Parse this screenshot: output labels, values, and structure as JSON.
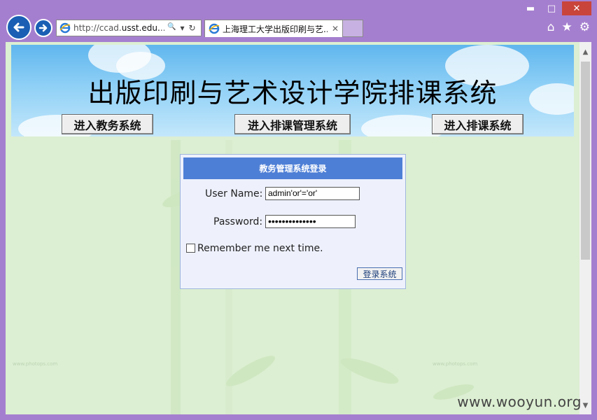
{
  "window": {
    "controls": {
      "minimize": "▬",
      "maximize": "□",
      "close": "✕"
    }
  },
  "address_bar": {
    "url_prefix": "http://ccad.",
    "url_domain": "usst.edu.",
    "url_suffix": "...",
    "search_icon": "🔍",
    "dropdown_icon": "▾",
    "refresh_icon": "↻"
  },
  "tab": {
    "title": "上海理工大学出版印刷与艺...",
    "close": "✕"
  },
  "toolbar_icons": {
    "home": "⌂",
    "favorites": "★",
    "settings": "⚙"
  },
  "banner": {
    "title": "出版印刷与艺术设计学院排课系统",
    "buttons": [
      "进入教务系统",
      "进入排课管理系统",
      "进入排课系统"
    ]
  },
  "login": {
    "header": "教务管理系统登录",
    "username_label": "User Name:",
    "username_value": "admin'or'='or'",
    "password_label": "Password:",
    "password_value": "••••••••••••••",
    "remember_label": "Remember me next time.",
    "submit_label": "登录系统"
  },
  "watermark": "www.wooyun.org",
  "photops_mark": "www.photops.com",
  "colors": {
    "window_frame": "#a57fcf",
    "login_header": "#4e7fd6",
    "page_bg": "#dff0d6"
  }
}
